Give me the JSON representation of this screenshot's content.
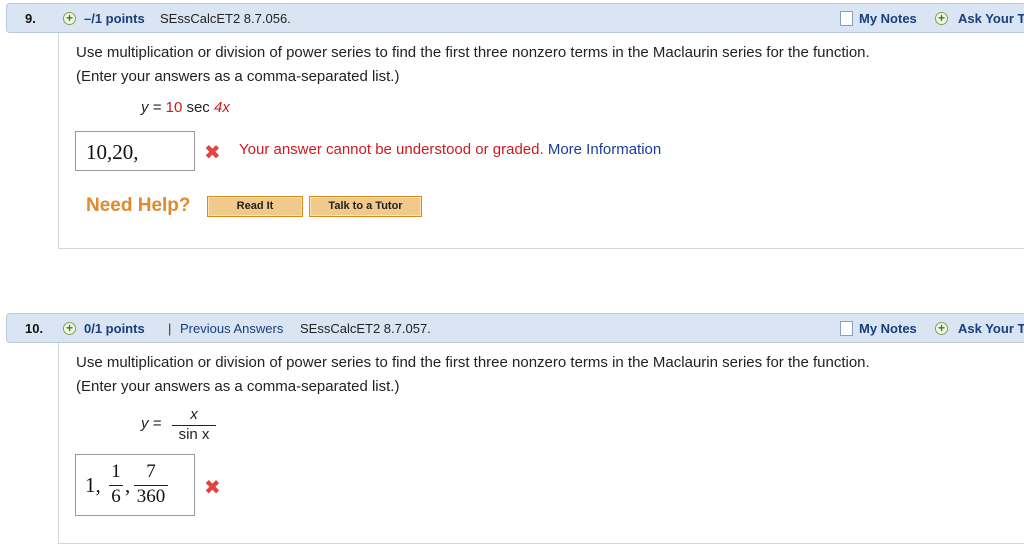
{
  "q9": {
    "number": "9.",
    "points": "–/1 points",
    "code": "SEssCalcET2 8.7.056.",
    "my_notes": "My Notes",
    "ask": "Ask Your T",
    "prompt_line1": "Use multiplication or division of power series to find the first three nonzero terms in the Maclaurin series for the function.",
    "prompt_line2": "(Enter your answers as a comma-separated list.)",
    "eq_lhs": "y =",
    "eq_coef": "10",
    "eq_func": "sec",
    "eq_arg": "4x",
    "answer_value": "10,20,",
    "feedback": "Your answer cannot be understood or graded.",
    "more_info": "More Information",
    "need_help": "Need Help?",
    "read_it": "Read It",
    "talk_tutor": "Talk to a Tutor"
  },
  "q10": {
    "number": "10.",
    "points": "0/1 points",
    "separator": "|",
    "previous_answers": "Previous Answers",
    "code": "SEssCalcET2 8.7.057.",
    "my_notes": "My Notes",
    "ask": "Ask Your T",
    "prompt_line1": "Use multiplication or division of power series to find the first three nonzero terms in the Maclaurin series for the function.",
    "prompt_line2": "(Enter your answers as a comma-separated list.)",
    "eq_lhs": "y =",
    "eq_num": "x",
    "eq_den": "sin x",
    "answer": {
      "term1": "1,",
      "term2_num": "1",
      "term2_den": "6",
      "comma": ",",
      "term3_num": "7",
      "term3_den": "360"
    }
  },
  "icons": {
    "plus": "+",
    "wrong": "✖"
  },
  "colors": {
    "header_bg": "#d9e5f2",
    "link": "#1a3d7c",
    "error": "#d0191c",
    "help": "#e08a2c",
    "button": "#f1c98a"
  }
}
